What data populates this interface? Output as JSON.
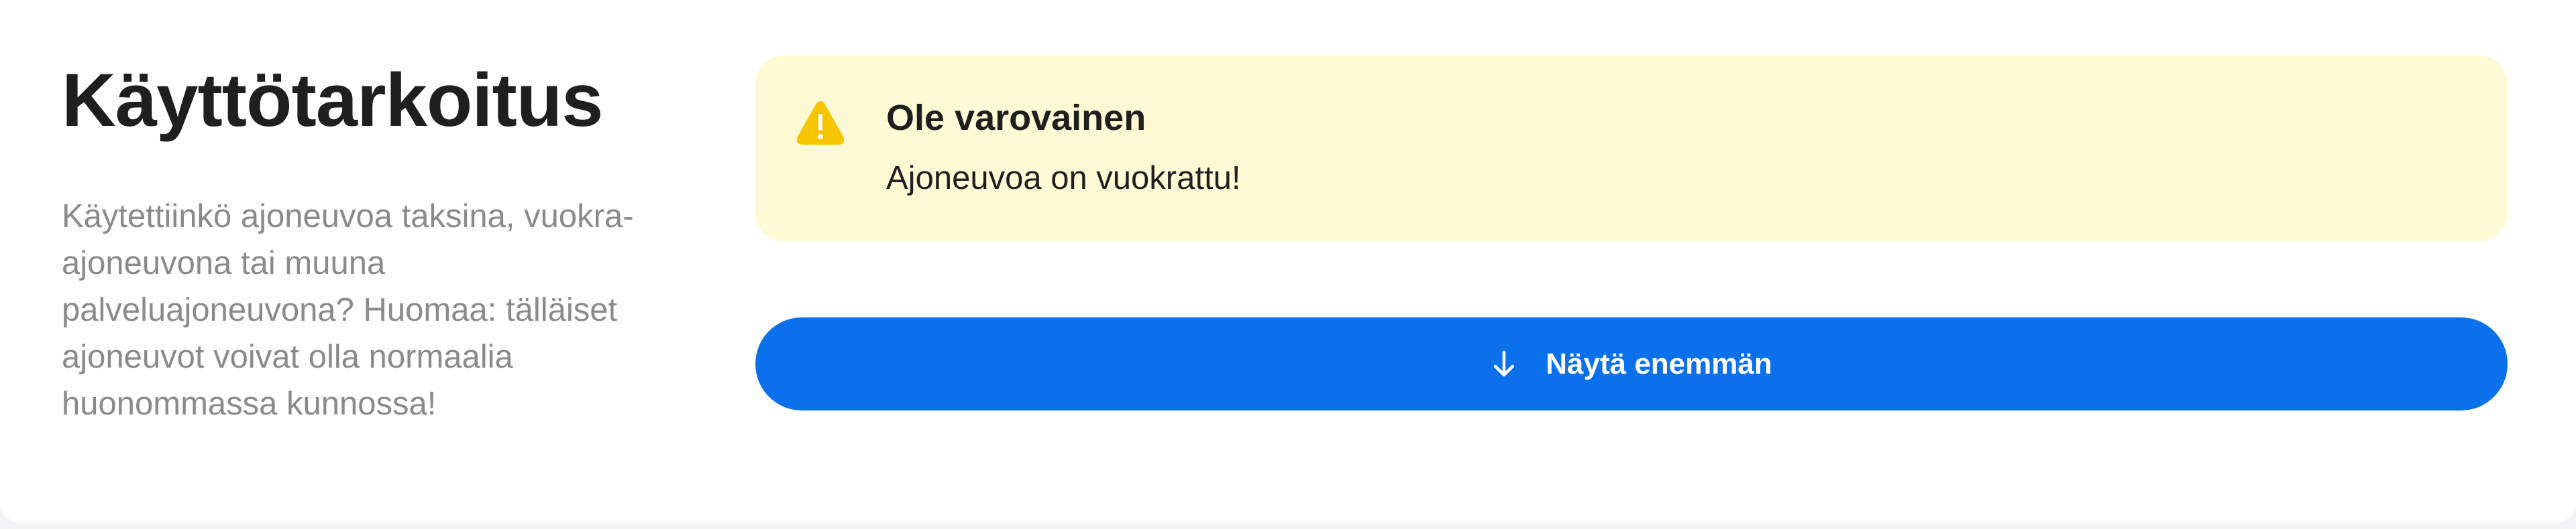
{
  "section": {
    "title": "Käyttötarkoitus",
    "description": "Käytettiinkö ajoneuvoa taksina, vuokra-ajoneuvona tai muuna palveluajoneuvona? Huomaa: tälläiset ajoneuvot voivat olla normaalia huonommassa kunnossa!"
  },
  "warning": {
    "icon": "warning-triangle-icon",
    "title": "Ole varovainen",
    "text": "Ajoneuvoa on vuokrattu!",
    "background_color": "#fefad5",
    "icon_color": "#f6c500"
  },
  "show_more": {
    "icon": "arrow-down-icon",
    "label": "Näytä enemmän",
    "color": "#0a70ec"
  }
}
